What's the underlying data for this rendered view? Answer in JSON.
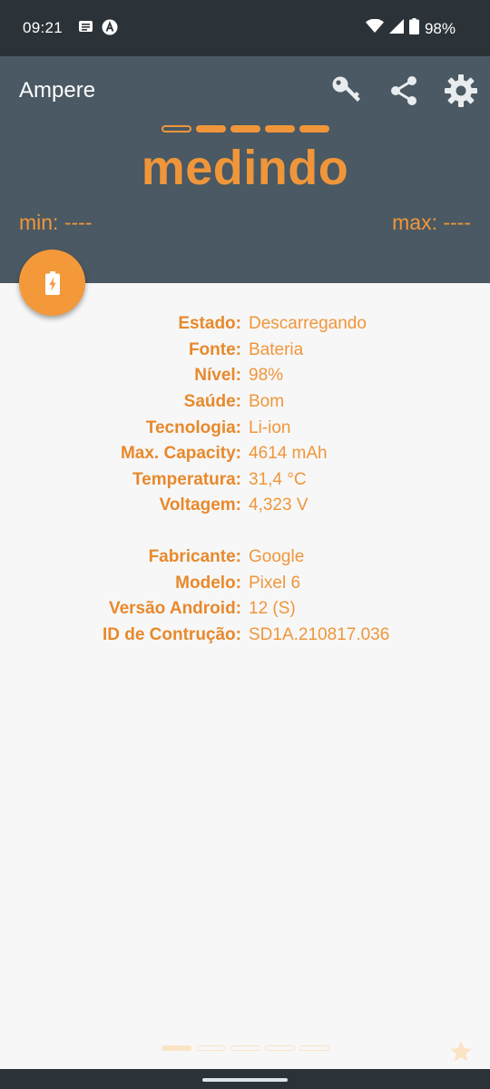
{
  "status_bar": {
    "time": "09:21",
    "battery_percent": "98%",
    "icons": [
      "notes-icon",
      "a-circle-icon",
      "wifi-icon",
      "signal-icon",
      "battery-icon"
    ]
  },
  "header": {
    "app_title": "Ampere",
    "status_text": "medindo",
    "min_label": "min: ----",
    "max_label": "max: ----",
    "actions": [
      "key-icon",
      "share-icon",
      "settings-icon"
    ],
    "page_dots_total": 5,
    "page_dots_active": 1
  },
  "battery_info": {
    "rows": [
      {
        "label": "Estado:",
        "value": "Descarregando"
      },
      {
        "label": "Fonte:",
        "value": "Bateria"
      },
      {
        "label": "Nível:",
        "value": "98%"
      },
      {
        "label": "Saúde:",
        "value": "Bom"
      },
      {
        "label": "Tecnologia:",
        "value": "Li-ion"
      },
      {
        "label": "Max. Capacity:",
        "value": "4614 mAh"
      },
      {
        "label": "Temperatura:",
        "value": "31,4 °C"
      },
      {
        "label": "Voltagem:",
        "value": "4,323 V"
      }
    ]
  },
  "device_info": {
    "rows": [
      {
        "label": "Fabricante:",
        "value": "Google"
      },
      {
        "label": "Modelo:",
        "value": "Pixel 6"
      },
      {
        "label": "Versão Android:",
        "value": "12 (S)"
      },
      {
        "label": "ID de Contrução:",
        "value": "SD1A.210817.036"
      }
    ]
  },
  "colors": {
    "accent": "#f0963a",
    "header_bg": "#4a5963",
    "status_bar_bg": "#2c3338",
    "content_bg": "#f7f7f7"
  }
}
